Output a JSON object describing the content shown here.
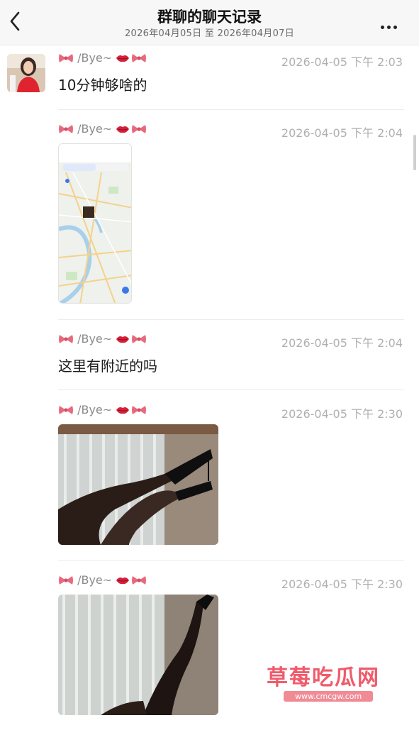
{
  "header": {
    "title": "群聊的聊天记录",
    "subtitle": "2026年04月05日 至 2026年04月07日"
  },
  "messages": [
    {
      "sender": "/Bye~",
      "time": "2026-04-05 下午 2:03",
      "type": "text",
      "text": "10分钟够啥的"
    },
    {
      "sender": "/Bye~",
      "time": "2026-04-05 下午 2:04",
      "type": "image",
      "image": "map-screenshot"
    },
    {
      "sender": "/Bye~",
      "time": "2026-04-05 下午 2:04",
      "type": "text",
      "text": "这里有附近的吗"
    },
    {
      "sender": "/Bye~",
      "time": "2026-04-05 下午 2:30",
      "type": "image",
      "image": "photo-legs-heels"
    },
    {
      "sender": "/Bye~",
      "time": "2026-04-05 下午 2:30",
      "type": "image",
      "image": "photo-legs-heels-2"
    }
  ],
  "watermark": {
    "title": "草莓吃瓜网",
    "url": "www.cmcgw.com"
  },
  "icons": {
    "back": "chevron-left-icon",
    "more": "more-dots-icon",
    "bow": "bow-emoji-icon",
    "lips": "lips-emoji-icon"
  },
  "colors": {
    "header_bg": "#f7f7f7",
    "bow": "#e8697d",
    "lips": "#d81f3a",
    "watermark": "#ef5b6b"
  }
}
